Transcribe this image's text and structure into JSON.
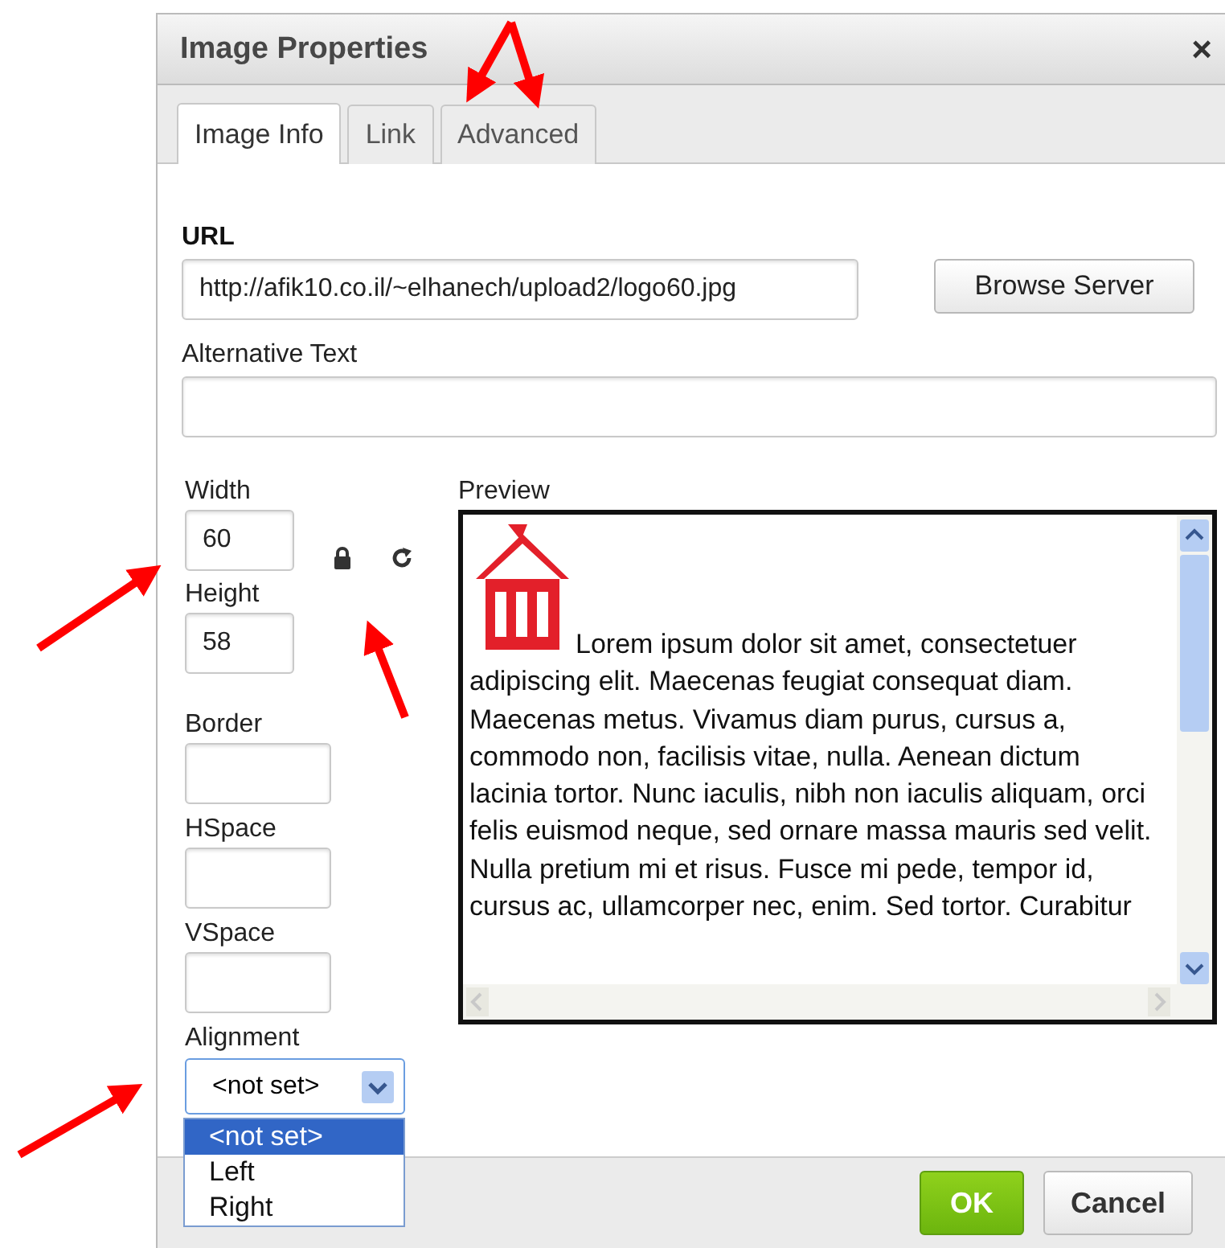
{
  "window": {
    "title": "Image Properties",
    "close": "×"
  },
  "tabs": [
    {
      "label": "Image Info",
      "selected": true
    },
    {
      "label": "Link",
      "selected": false
    },
    {
      "label": "Advanced",
      "selected": false
    }
  ],
  "url": {
    "label": "URL",
    "value": "http://afik10.co.il/~elhanech/upload2/logo60.jpg"
  },
  "browse_button": "Browse Server",
  "alt_text": {
    "label": "Alternative Text"
  },
  "width": {
    "label": "Width",
    "value": "60"
  },
  "height": {
    "label": "Height",
    "value": "58"
  },
  "border": {
    "label": "Border"
  },
  "hspace": {
    "label": "HSpace"
  },
  "vspace": {
    "label": "VSpace"
  },
  "alignment": {
    "label": "Alignment",
    "value": "<not set>",
    "options": [
      {
        "label": "<not set>",
        "selected": true
      },
      {
        "label": "Left",
        "selected": false
      },
      {
        "label": "Right",
        "selected": false
      }
    ]
  },
  "preview": {
    "label": "Preview",
    "text": "Lorem ipsum dolor sit amet, consectetuer adipiscing elit. Maecenas feugiat consequat diam. Maecenas metus. Vivamus diam purus, cursus a, commodo non, facilisis vitae, nulla. Aenean dictum lacinia tortor. Nunc iaculis, nibh non iaculis aliquam, orci felis euismod neque, sed ornare massa mauris sed velit. Nulla pretium mi et risus. Fusce mi pede, tempor id, cursus ac, ullamcorper nec, enim. Sed tortor. Curabitur"
  },
  "buttons": [
    {
      "label": "OK",
      "kind": "primary"
    },
    {
      "label": "Cancel",
      "kind": "secondary"
    }
  ]
}
